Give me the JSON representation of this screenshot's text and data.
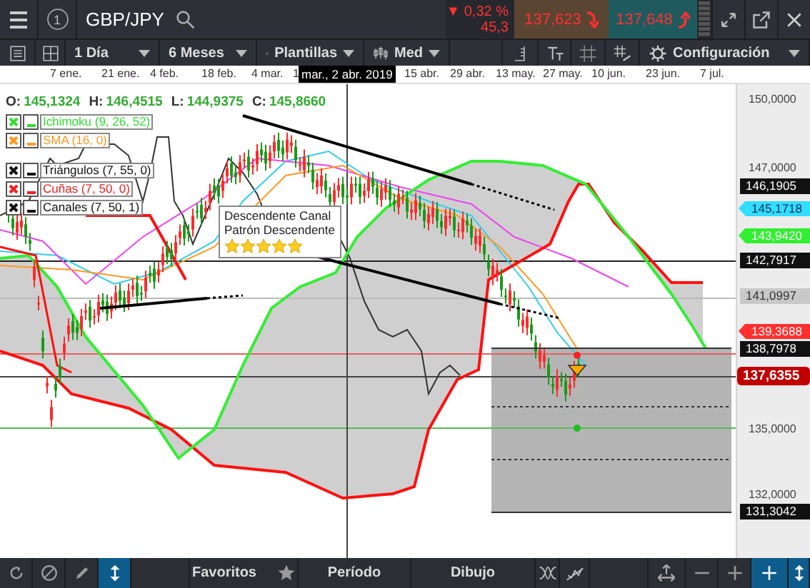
{
  "header": {
    "badge": "1",
    "symbol": "GBP/JPY",
    "change_pct": "▼ 0,32 %",
    "change_pts": "45,3",
    "sell": "137,623",
    "buy": "137,648"
  },
  "toolbar": [
    {
      "kind": "icon"
    },
    {
      "kind": "icon"
    },
    {
      "kind": "dropdown",
      "label": "1 Día"
    },
    {
      "kind": "dropdown",
      "label": "6 Meses"
    },
    {
      "kind": "dropdown",
      "label": "Plantillas"
    },
    {
      "kind": "dropdown",
      "label": "Med"
    },
    {
      "kind": "blank"
    },
    {
      "kind": "icon"
    },
    {
      "kind": "icon"
    },
    {
      "kind": "icon"
    },
    {
      "kind": "icon"
    },
    {
      "kind": "dropdown",
      "label": "Configuración"
    }
  ],
  "date_axis": {
    "labels": [
      "7 ene.",
      "21 ene.",
      "4 feb.",
      "18 feb.",
      "4 mar.",
      "1",
      "15 abr.",
      "29 abr.",
      "13 may.",
      "27 may.",
      "10 jun.",
      "23 jun.",
      "7 jul."
    ],
    "crosshair_label": "mar., 2 abr. 2019"
  },
  "ohlc": [
    {
      "label": "O:",
      "value": "145,1324"
    },
    {
      "label": "H:",
      "value": "146,4515"
    },
    {
      "label": "L:",
      "value": "144,9375"
    },
    {
      "label": "C:",
      "value": "145,8660"
    }
  ],
  "indicators": [
    {
      "name": "Ichimoku (9, 26, 52)",
      "color": "#33dd33"
    },
    {
      "name": "SMA (16, 0)",
      "color": "#ff9922"
    }
  ],
  "drawings": [
    {
      "name": "Triángulos (7, 55, 0)",
      "color": "#111111"
    },
    {
      "name": "Cuñas (7, 50, 0)",
      "color": "#ee2222"
    },
    {
      "name": "Canales (7, 50, 1)",
      "color": "#111111"
    }
  ],
  "tooltip": {
    "lines": [
      "Descendente Canal",
      "Patrón Descendente"
    ],
    "stars": 5
  },
  "price_axis": {
    "ticks": [
      "150,0000",
      "147,0000",
      "135,0000",
      "132,0000"
    ],
    "tags": [
      {
        "text": "146,1905",
        "kind": "box",
        "color": "#111111"
      },
      {
        "text": "145,1718",
        "kind": "arrow",
        "color": "#33ddff"
      },
      {
        "text": "143,9420",
        "kind": "arrow",
        "color": "#33ee33"
      },
      {
        "text": "142,7917",
        "kind": "box",
        "color": "#111111"
      },
      {
        "text": "141,0997",
        "kind": "box",
        "color": "#c8c8c8"
      },
      {
        "text": "139,3688",
        "kind": "arrow",
        "color": "#ff3030"
      },
      {
        "text": "138,7978",
        "kind": "box",
        "color": "#111111"
      },
      {
        "text": "137,6355",
        "kind": "round",
        "color": "#c00000"
      },
      {
        "text": "131,3042",
        "kind": "box",
        "color": "#111111"
      }
    ]
  },
  "bottom_bar": [
    {
      "kind": "icon",
      "selected": false
    },
    {
      "kind": "icon",
      "selected": false
    },
    {
      "kind": "icon",
      "selected": false
    },
    {
      "kind": "icon",
      "selected": true
    },
    {
      "kind": "blank"
    },
    {
      "kind": "label",
      "label": "Favoritos"
    },
    {
      "kind": "label",
      "label": "Período"
    },
    {
      "kind": "label",
      "label": "Dibujo"
    },
    {
      "kind": "icon",
      "selected": false
    },
    {
      "kind": "icon",
      "selected": false
    },
    {
      "kind": "blank"
    },
    {
      "kind": "icon",
      "selected": false
    },
    {
      "kind": "icon",
      "selected": false
    },
    {
      "kind": "icon",
      "selected": false
    },
    {
      "kind": "icon",
      "selected": true
    },
    {
      "kind": "icon",
      "selected": true
    }
  ]
}
